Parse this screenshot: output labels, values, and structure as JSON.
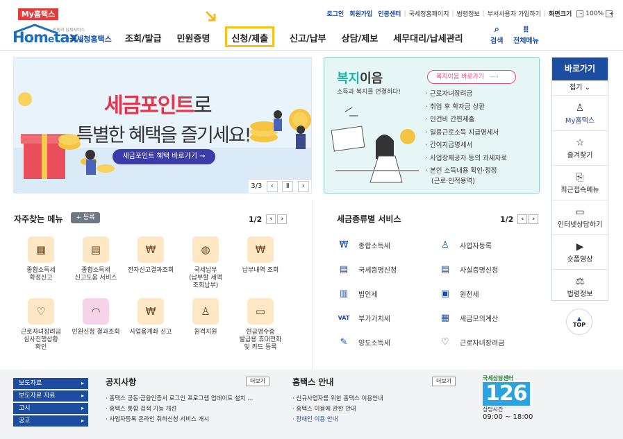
{
  "topbar": {
    "my_tab": "My홈택스",
    "links": [
      "로그인",
      "회원가입",
      "인증센터",
      "국세청홈페이지",
      "법령정보",
      "부서사용자 가입하기",
      "화면크기"
    ],
    "zoom": "100%",
    "zoom_minus": "-",
    "zoom_plus": "+"
  },
  "logo": {
    "text": "Hom tax.",
    "e_letter": "e",
    "sub": "민원과 납세서비스",
    "org": "국세청홈택스"
  },
  "nav": {
    "items": [
      "조회/발급",
      "민원증명",
      "신청/제출",
      "신고/납부",
      "상담/제보",
      "세무대리/납세관리"
    ],
    "search": "검색",
    "allmenu": "전체메뉴"
  },
  "banner": {
    "line1_highlight": "세금포인트",
    "line1_rest": "로",
    "line2": "특별한 혜택을 즐기세요!",
    "button": "세금포인트 혜택 바로가기 →",
    "pager": "3/3"
  },
  "welfare": {
    "title_a": "복지",
    "title_b": "이음",
    "subtitle": "소득과 복지를 연결하다!",
    "button": "복지이음 바로가기",
    "items": [
      "근로자녀장려금",
      "취업 후 학자금 상환",
      "인건비 간편제출",
      "일용근로소득 지급명세서",
      "간이지급명세서",
      "사업장제공자 등의 과세자료",
      "본인 소득내용 확인·정정",
      "(근로·인적용역)"
    ]
  },
  "side": {
    "header": "바로가기",
    "collapse": "접기",
    "items": [
      "My홈택스",
      "즐겨찾기",
      "최근접속메뉴",
      "인터넷상담하기",
      "숏폼영상",
      "법령정보"
    ],
    "top": "TOP"
  },
  "freq": {
    "title": "자주찾는 메뉴",
    "register": "등록",
    "page": "1/2",
    "items": [
      [
        "종합소득세",
        "확정신고"
      ],
      [
        "종합소득세",
        "신고도움 서비스"
      ],
      [
        "전자신고결과조회"
      ],
      [
        "국세납부",
        "(납부할 세액",
        "조회납부)"
      ],
      [
        "납부내역 조회"
      ],
      [
        "근로자녀장려금",
        "심사진행상황",
        "확인"
      ],
      [
        "민원신청 결과조회"
      ],
      [
        "사업용계좌 신고"
      ],
      [
        "원격지원"
      ],
      [
        "현금영수증",
        "발급용 휴대전화",
        "및 카드 등록"
      ]
    ]
  },
  "taxsvc": {
    "title": "세금종류별 서비스",
    "page": "1/2",
    "items": [
      "종합소득세",
      "사업자등록",
      "국세증명신청",
      "사실증명신청",
      "법인세",
      "원천세",
      "부가가치세",
      "세금모의계산",
      "양도소득세",
      "근로자녀장려금"
    ]
  },
  "bottom": {
    "left": [
      "보도자료",
      "보도자료 자료",
      "고시",
      "공고"
    ],
    "notice_title": "공지사항",
    "notice_more": "더보기",
    "notices": [
      "홈택스 공동·금융인증서 로그인 프로그램 업데이트 설치 ...",
      "홈택스 통합 검색 기능 개선",
      "사업자등록 온라인 취하신청 서비스 개시"
    ],
    "guide_title": "홈택스 안내",
    "guide_more": "더보기",
    "guides": [
      "신규사업자를 위한 홈택스 이용안내",
      "홈택스 이용에 관한 안내",
      "장애인 이용 안내"
    ],
    "center_top": "국세상담센터",
    "center_num": "126",
    "center_label": "상담시간",
    "center_hours": "09:00 ~ 18:00"
  },
  "colors": {
    "brand": "#1c4da1",
    "highlight": "#f6c31a",
    "red": "#e23c3c",
    "teal": "#1ab3a6"
  }
}
